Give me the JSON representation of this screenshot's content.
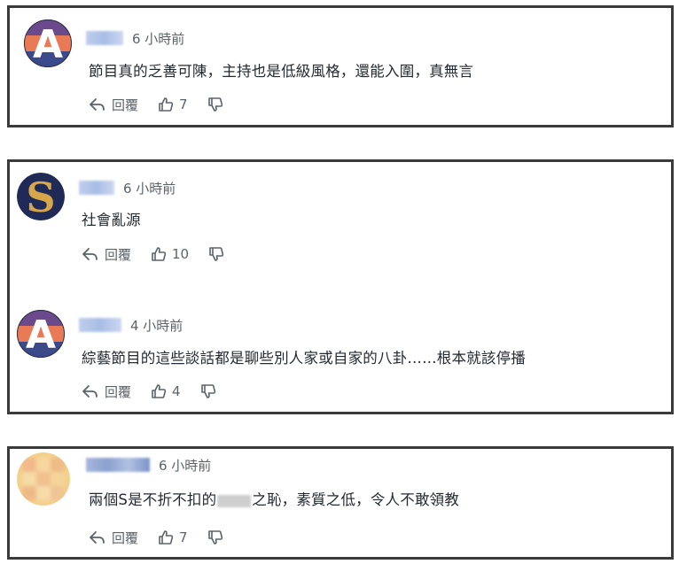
{
  "comments": [
    {
      "time": "6 小時前",
      "text": "節目真的乏善可陳，主持也是低級風格，還能入圍，真無言",
      "reply": "回覆",
      "likes": "7"
    },
    {
      "time": "6 小時前",
      "text": "社會亂源",
      "reply": "回覆",
      "likes": "10"
    },
    {
      "time": "4 小時前",
      "text": "綜藝節目的這些談話都是聊些別人家或自家的八卦……根本就該停播",
      "reply": "回覆",
      "likes": "4"
    },
    {
      "time": "6 小時前",
      "text_before": "兩個S是不折不扣的",
      "text_after": "之恥，素質之低，令人不敢領教",
      "reply": "回覆",
      "likes": "7"
    }
  ],
  "avatars": [
    {
      "letter": "A",
      "color": "#2b2f4a"
    },
    {
      "letter": "S",
      "color": "#1f2a56"
    },
    {
      "letter": "A",
      "color": "#2b2f4a"
    }
  ],
  "icons": [
    "reply-icon",
    "thumbs-up-icon",
    "thumbs-down-icon"
  ]
}
